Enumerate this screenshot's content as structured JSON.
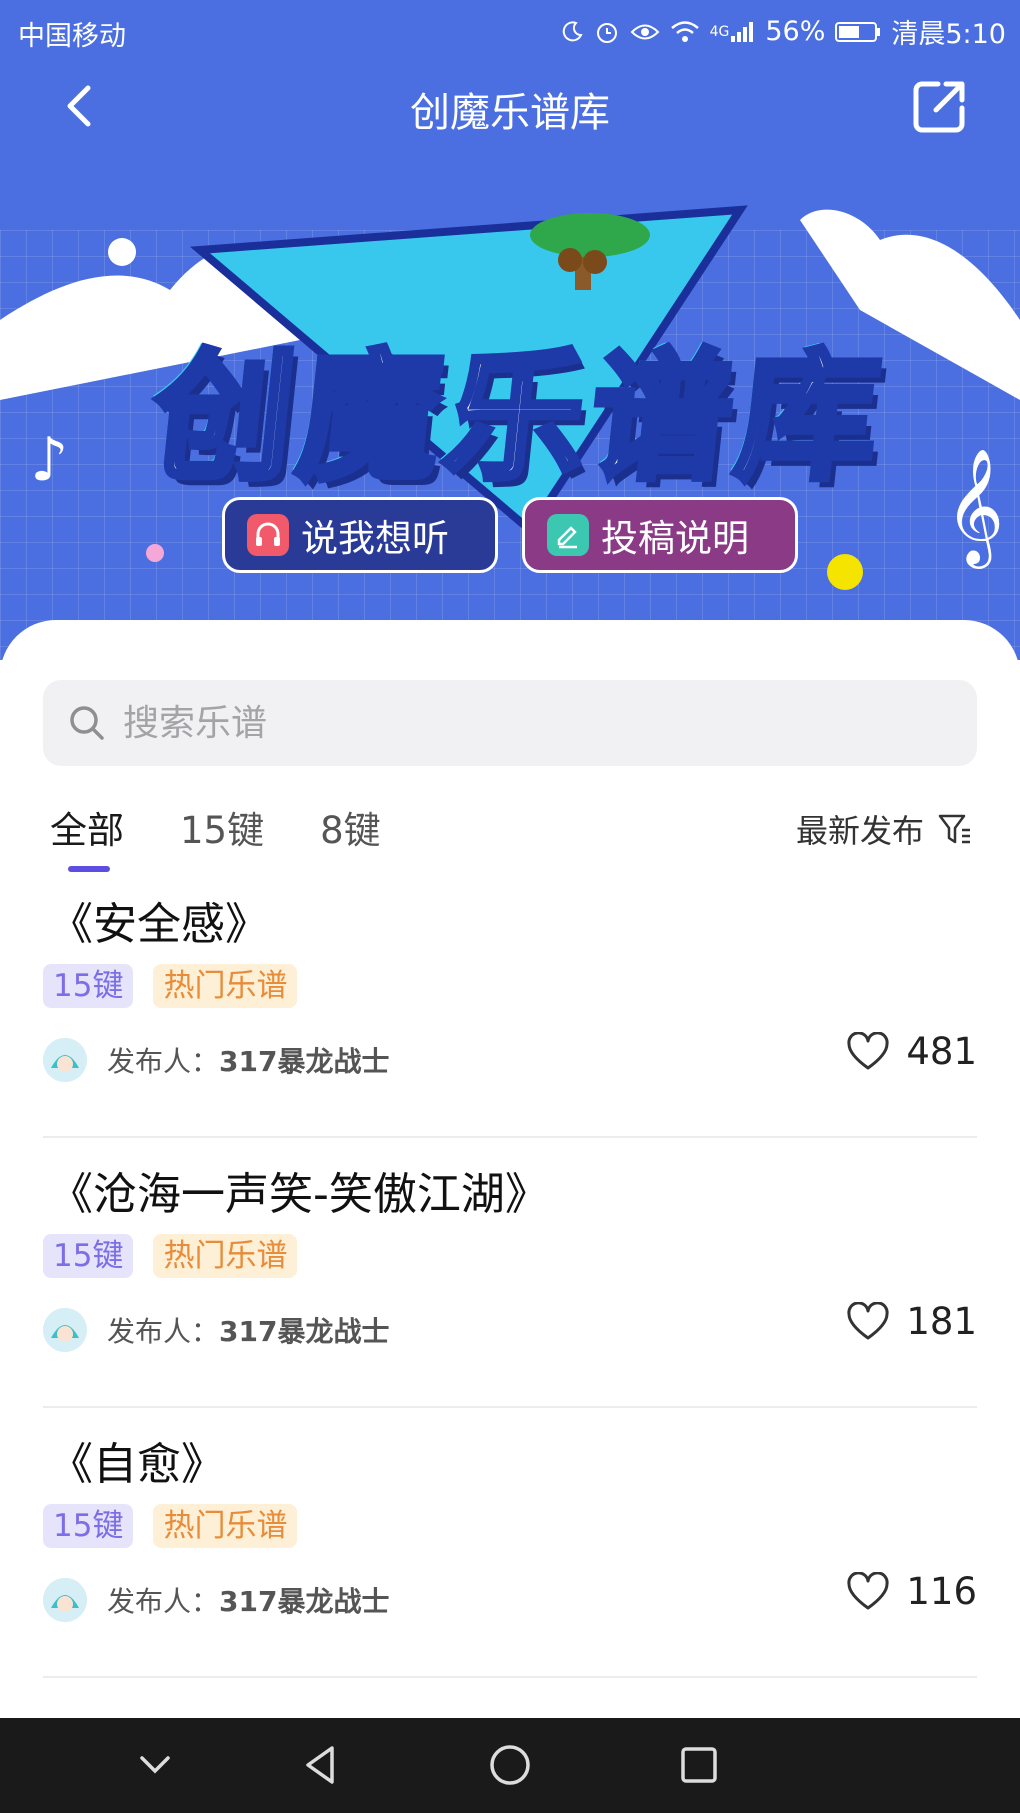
{
  "status_bar": {
    "carrier": "中国移动",
    "network": "4G",
    "battery": "56%",
    "time": "清晨5:10"
  },
  "nav": {
    "title": "创魔乐谱库",
    "back_icon": "chevron-left-icon",
    "share_icon": "share-icon"
  },
  "banner": {
    "title": "创魔乐谱库",
    "buttons": [
      {
        "label": "说我想听",
        "icon": "headphones-icon",
        "color": "#2a3b97"
      },
      {
        "label": "投稿说明",
        "icon": "edit-icon",
        "color": "#8b3b86"
      }
    ]
  },
  "search": {
    "placeholder": "搜索乐谱"
  },
  "tabs": [
    {
      "label": "全部",
      "active": true
    },
    {
      "label": "15键",
      "active": false
    },
    {
      "label": "8键",
      "active": false
    }
  ],
  "sort": {
    "label": "最新发布"
  },
  "scores": [
    {
      "title": "《安全感》",
      "tags": [
        "15键",
        "热门乐谱"
      ],
      "publisher_prefix": "发布人：",
      "publisher": "317暴龙战士",
      "likes": "481"
    },
    {
      "title": "《沧海一声笑-笑傲江湖》",
      "tags": [
        "15键",
        "热门乐谱"
      ],
      "publisher_prefix": "发布人：",
      "publisher": "317暴龙战士",
      "likes": "181"
    },
    {
      "title": "《自愈》",
      "tags": [
        "15键",
        "热门乐谱"
      ],
      "publisher_prefix": "发布人：",
      "publisher": "317暴龙战士",
      "likes": "116"
    }
  ],
  "colors": {
    "header_blue": "#4b6fe0",
    "accent_purple": "#5d4de0",
    "tag_key_text": "#7c6ee6",
    "tag_hot_text": "#e88c3a"
  }
}
